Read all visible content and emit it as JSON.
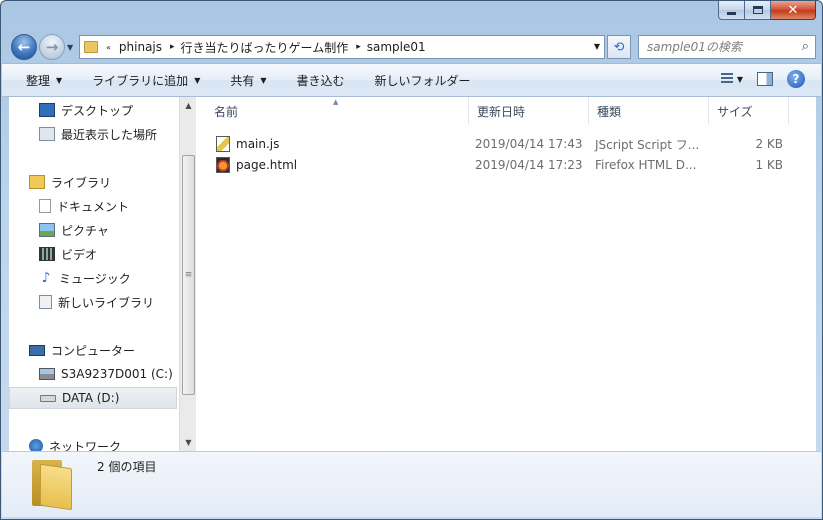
{
  "window": {
    "caption_buttons": {
      "minimize_icon": "minimize-icon",
      "maximize_icon": "maximize-icon",
      "close_icon": "close-icon",
      "close_glyph": "✕"
    }
  },
  "navigation": {
    "back_icon": "back-arrow-icon",
    "back_glyph": "←",
    "forward_icon": "forward-arrow-icon",
    "forward_glyph": "→",
    "history_glyph": "▼"
  },
  "address": {
    "overflow": "«",
    "crumbs": [
      "phinajs",
      "行き当たりばったりゲーム制作",
      "sample01"
    ],
    "chevron": "▸",
    "drop_glyph": "▼",
    "refresh_glyph": "⟲"
  },
  "search": {
    "placeholder": "sample01の検索",
    "icon_glyph": "⌕"
  },
  "toolbar": {
    "organize": "整理",
    "add_to_library": "ライブラリに追加",
    "share": "共有",
    "burn": "書き込む",
    "new_folder": "新しいフォルダー",
    "caret": "▼",
    "help_glyph": "?"
  },
  "sidebar": {
    "favorites": [
      {
        "label": "デスクトップ",
        "icon": "desktop-icon"
      },
      {
        "label": "最近表示した場所",
        "icon": "recent-places-icon"
      }
    ],
    "libraries_label": "ライブラリ",
    "libraries": [
      {
        "label": "ドキュメント",
        "icon": "documents-icon"
      },
      {
        "label": "ピクチャ",
        "icon": "pictures-icon"
      },
      {
        "label": "ビデオ",
        "icon": "videos-icon"
      },
      {
        "label": "ミュージック",
        "icon": "music-icon"
      },
      {
        "label": "新しいライブラリ",
        "icon": "new-library-icon"
      }
    ],
    "computer_label": "コンピューター",
    "drives": [
      {
        "label": "S3A9237D001 (C:)",
        "icon": "local-disk-icon"
      },
      {
        "label": "DATA (D:)",
        "icon": "drive-icon",
        "selected": true
      }
    ],
    "network_label": "ネットワーク",
    "music_glyph": "♪",
    "scroll_up_glyph": "▲",
    "scroll_down_glyph": "▼",
    "scroll_grip": "≡"
  },
  "file_list": {
    "columns": [
      "名前",
      "更新日時",
      "種類",
      "サイズ"
    ],
    "sort_glyph": "▲",
    "files": [
      {
        "name": "main.js",
        "modified": "2019/04/14 17:43",
        "type": "JScript Script フ...",
        "size": "2 KB",
        "icon": "jscript-file-icon"
      },
      {
        "name": "page.html",
        "modified": "2019/04/14 17:23",
        "type": "Firefox HTML D...",
        "size": "1 KB",
        "icon": "firefox-html-icon"
      }
    ]
  },
  "details": {
    "item_count": "2 個の項目",
    "icon": "folder-icon"
  },
  "colors": {
    "accent": "#2a6bd1",
    "title_glass": "#bcd4ec",
    "close_red": "#c23c1c"
  }
}
